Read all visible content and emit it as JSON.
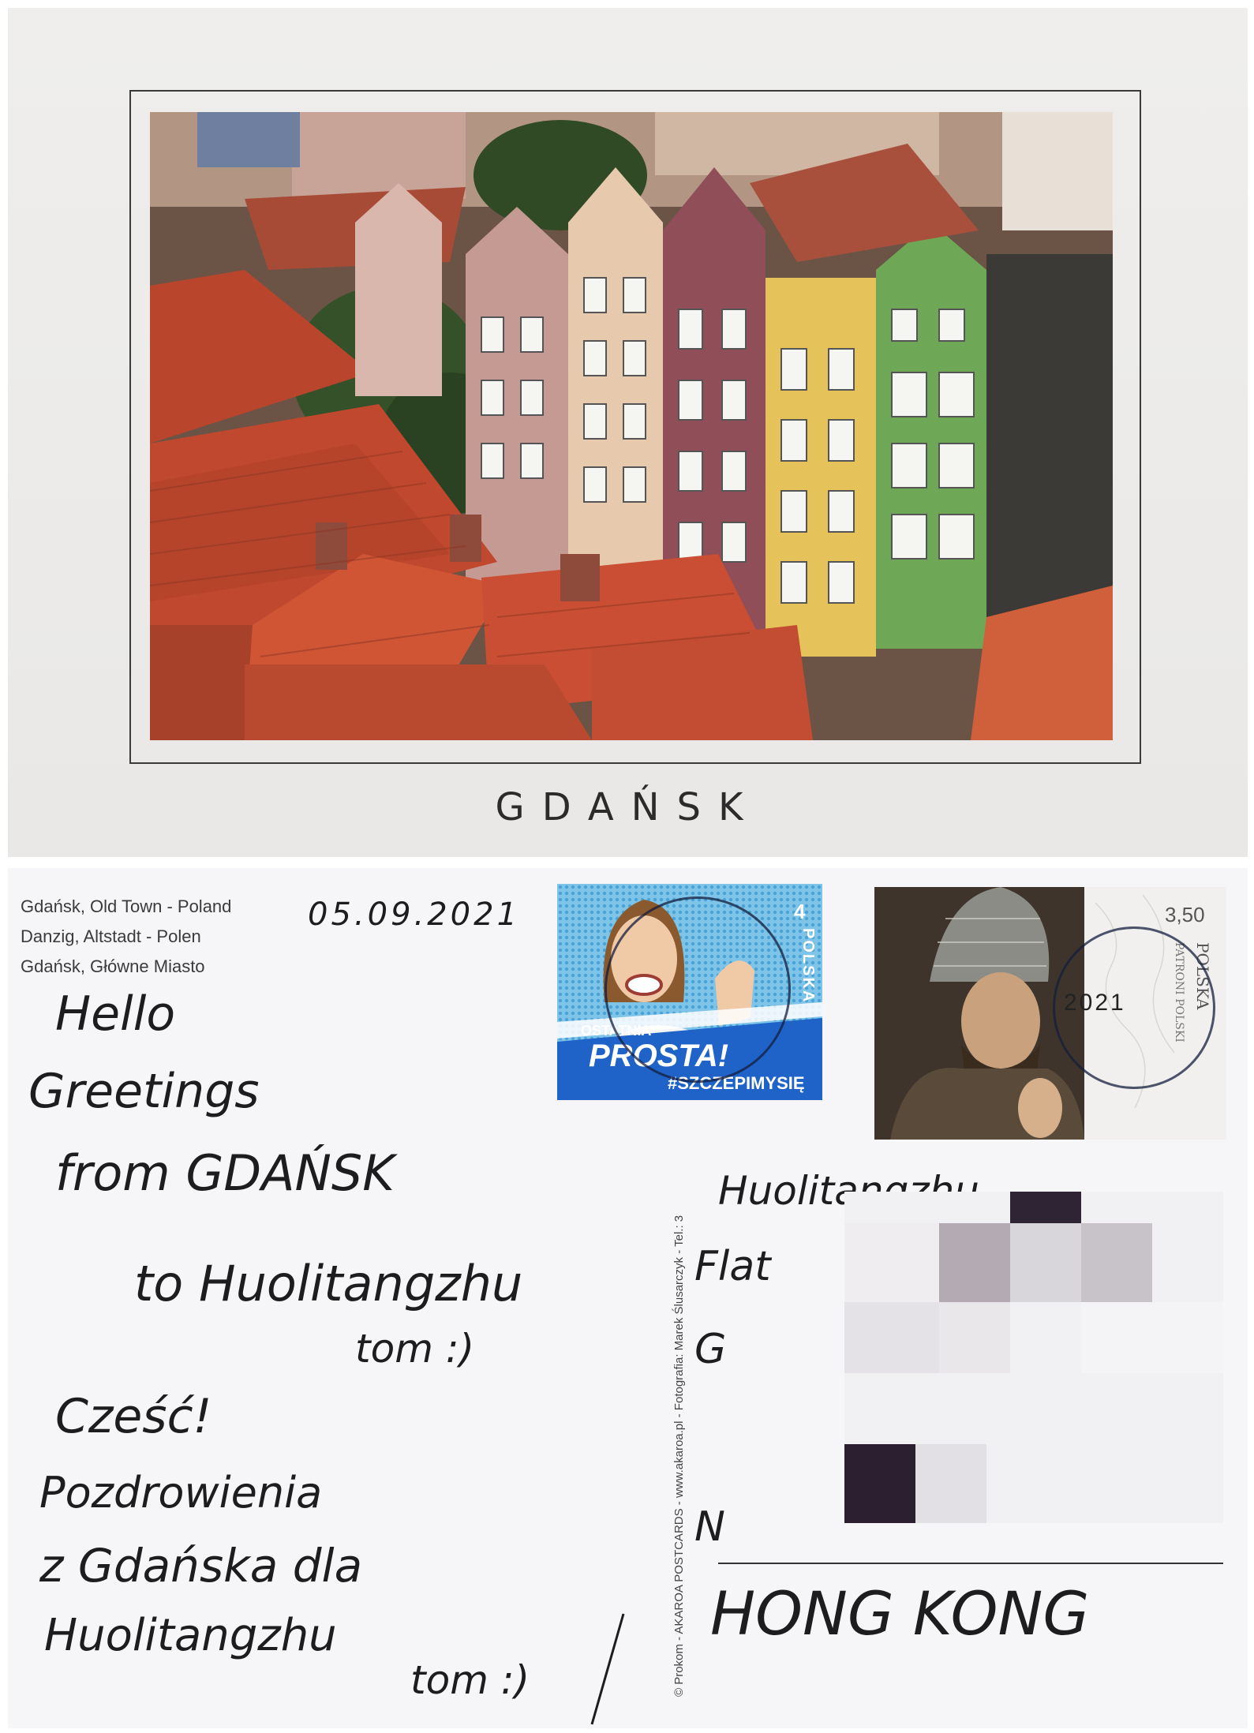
{
  "front": {
    "city": "GDAŃSK"
  },
  "back": {
    "location_lines": [
      "Gdańsk, Old Town - Poland",
      "Danzig, Altstadt - Polen",
      "Gdańsk, Główne Miasto"
    ],
    "date": "05.09.2021",
    "message_lines": [
      "Hello",
      "Greetings",
      "from GDAŃSK",
      "to Huolitangzhu",
      "tom :)",
      "Cześć!",
      "Pozdrowienia",
      "z Gdańska dla",
      "Huolitangzhu",
      "tom :)"
    ],
    "credit": "© Prokom - AKAROA POSTCARDS - www.akaroa.pl - Fotografia: Marek Ślusarczyk - Tel.: 3",
    "stamp1": {
      "value": "4",
      "country": "POLSKA",
      "slogan1": "OSTATNIA",
      "slogan2": "PROSTA!",
      "hashtag": "#SZCZEPIMYSIĘ"
    },
    "stamp2": {
      "value": "3,50",
      "country": "POLSKA",
      "series": "PATRONI POLSKI"
    },
    "postmark_text": "2021",
    "address": {
      "name": "Huolitangzhu",
      "line2": "Flat",
      "line3": "G",
      "line5": "N",
      "country": "HONG KONG"
    },
    "colors": {
      "stamp1_bg": "#6cbbe3",
      "stamp1_band": "#1f63c8",
      "ink": "#1d1d1f"
    }
  }
}
